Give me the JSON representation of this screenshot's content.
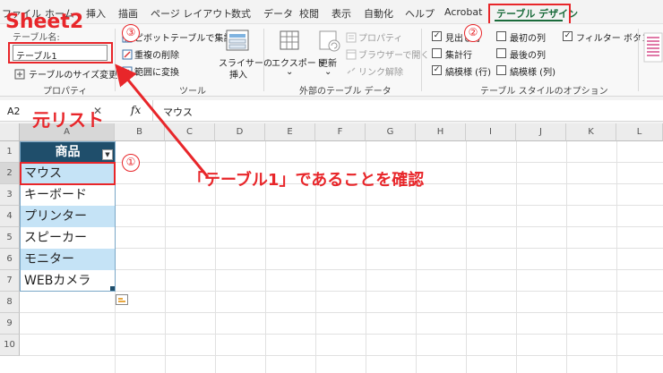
{
  "menu": {
    "items": [
      "ファイル",
      "ホーム",
      "挿入",
      "描画",
      "ページ レイアウト",
      "数式",
      "データ",
      "校閲",
      "表示",
      "自動化",
      "ヘルプ",
      "Acrobat",
      "テーブル デザイン"
    ]
  },
  "ribbon": {
    "table_name_label": "テーブル名:",
    "table_name_value": "テーブル1",
    "resize_label": "テーブルのサイズ変更",
    "group_properties": "プロパティ",
    "pivot_label": "ピボットテーブルで集計",
    "remove_dup_label": "重複の削除",
    "convert_range_label": "範囲に変換",
    "slicer_label_1": "スライサーの",
    "slicer_label_2": "挿入",
    "group_tools": "ツール",
    "export_label": "エクスポート",
    "refresh_label": "更新",
    "prop_label": "プロパティ",
    "browser_label": "ブラウザーで開く",
    "unlink_label": "リンク解除",
    "group_external": "外部のテーブル データ",
    "opt_header": "見出し行",
    "opt_total": "集計行",
    "opt_banded_rows": "縞模様 (行)",
    "opt_first_col": "最初の列",
    "opt_last_col": "最後の列",
    "opt_banded_cols": "縞模様 (列)",
    "opt_filter": "フィルター ボタン",
    "opt_header_checked": true,
    "opt_total_checked": false,
    "opt_banded_rows_checked": true,
    "opt_first_col_checked": false,
    "opt_last_col_checked": false,
    "opt_banded_cols_checked": false,
    "opt_filter_checked": true,
    "group_style_options": "テーブル スタイルのオプション"
  },
  "formula_bar": {
    "name_box": "A2",
    "fx": "fx",
    "content": "マウス"
  },
  "grid": {
    "columns": [
      "A",
      "B",
      "C",
      "D",
      "E",
      "F",
      "G",
      "H",
      "I",
      "J",
      "K",
      "L"
    ],
    "rows": [
      "1",
      "2",
      "3",
      "4",
      "5",
      "6",
      "7",
      "8",
      "9",
      "10"
    ],
    "header_cell": "商品",
    "cells": [
      "マウス",
      "キーボード",
      "プリンター",
      "スピーカー",
      "モニター",
      "WEBカメラ"
    ]
  },
  "annotations": {
    "sheet": "Sheet2",
    "moto_list": "元リスト",
    "callout": "「テーブル1」であることを確認",
    "num1": "①",
    "num2": "②",
    "num3": "③"
  },
  "colors": {
    "accent_red": "#e8262a",
    "table_header": "#1f4e6b",
    "band": "#c5e3f6",
    "excel_green": "#1a6b3b"
  }
}
